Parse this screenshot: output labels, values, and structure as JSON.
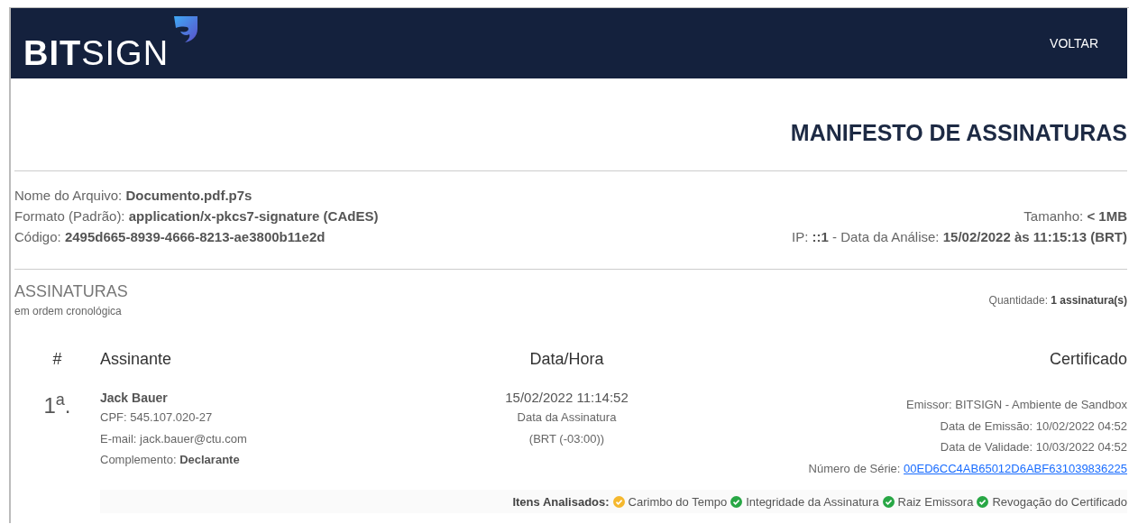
{
  "header": {
    "logo": {
      "bold_part": "BIT",
      "light_part": "SIGN"
    },
    "back_link": "VOLTAR"
  },
  "title": "MANIFESTO DE ASSINATURAS",
  "file_info": {
    "left": [
      "Nome do Arquivo: **Documento.pdf.p7s**",
      "Formato (Padrão): **application/x-pkcs7-signature (CAdES)**",
      "Código: **2495d665-8939-4666-8213-ae3800b11e2d**"
    ],
    "right": [
      "Tamanho: **< 1MB**",
      "IP: **::1** - Data da Análise: **15/02/2022 às 11:15:13 (BRT)**"
    ]
  },
  "signatures": {
    "heading": "ASSINATURAS",
    "subheading": "em ordem cronológica",
    "count": "Quantidade: **1 assinatura(s)**",
    "columns": [
      "#",
      "Assinante",
      "Data/Hora",
      "Certificado"
    ],
    "rows": [
      {
        "number": "1$^{a}$.",
        "name": "Jack Bauer",
        "details": [
          "CPF: 545.107.020-27",
          "E-mail: jack.bauer@ctu.com",
          "Complemento: **Declarante**"
        ],
        "datetime": "15/02/2022 11:14:52",
        "date_label": "Data da Assinatura",
        "timezone": "(BRT (-03:00))",
        "certificate": [
          "Emissor: BITSIGN - Ambiente de Sandbox",
          "Data de Emissão: 10/02/2022 04:52",
          "Data de Validade: 10/03/2022 04:52"
        ],
        "serial_label": "Número de Série:",
        "serial": "00ED6CC4AB65012D6ABF631039836225",
        "checks_label": "Itens Analisados:",
        "checks": [
          {
            "label": "Carimbo do Tempo",
            "color": "#f5b82e"
          },
          {
            "label": "Integridade da Assinatura",
            "color": "#28a745"
          },
          {
            "label": "Raiz Emissora",
            "color": "#28a745"
          },
          {
            "label": "Revogação do Certificado",
            "color": "#28a745"
          }
        ]
      }
    ]
  }
}
